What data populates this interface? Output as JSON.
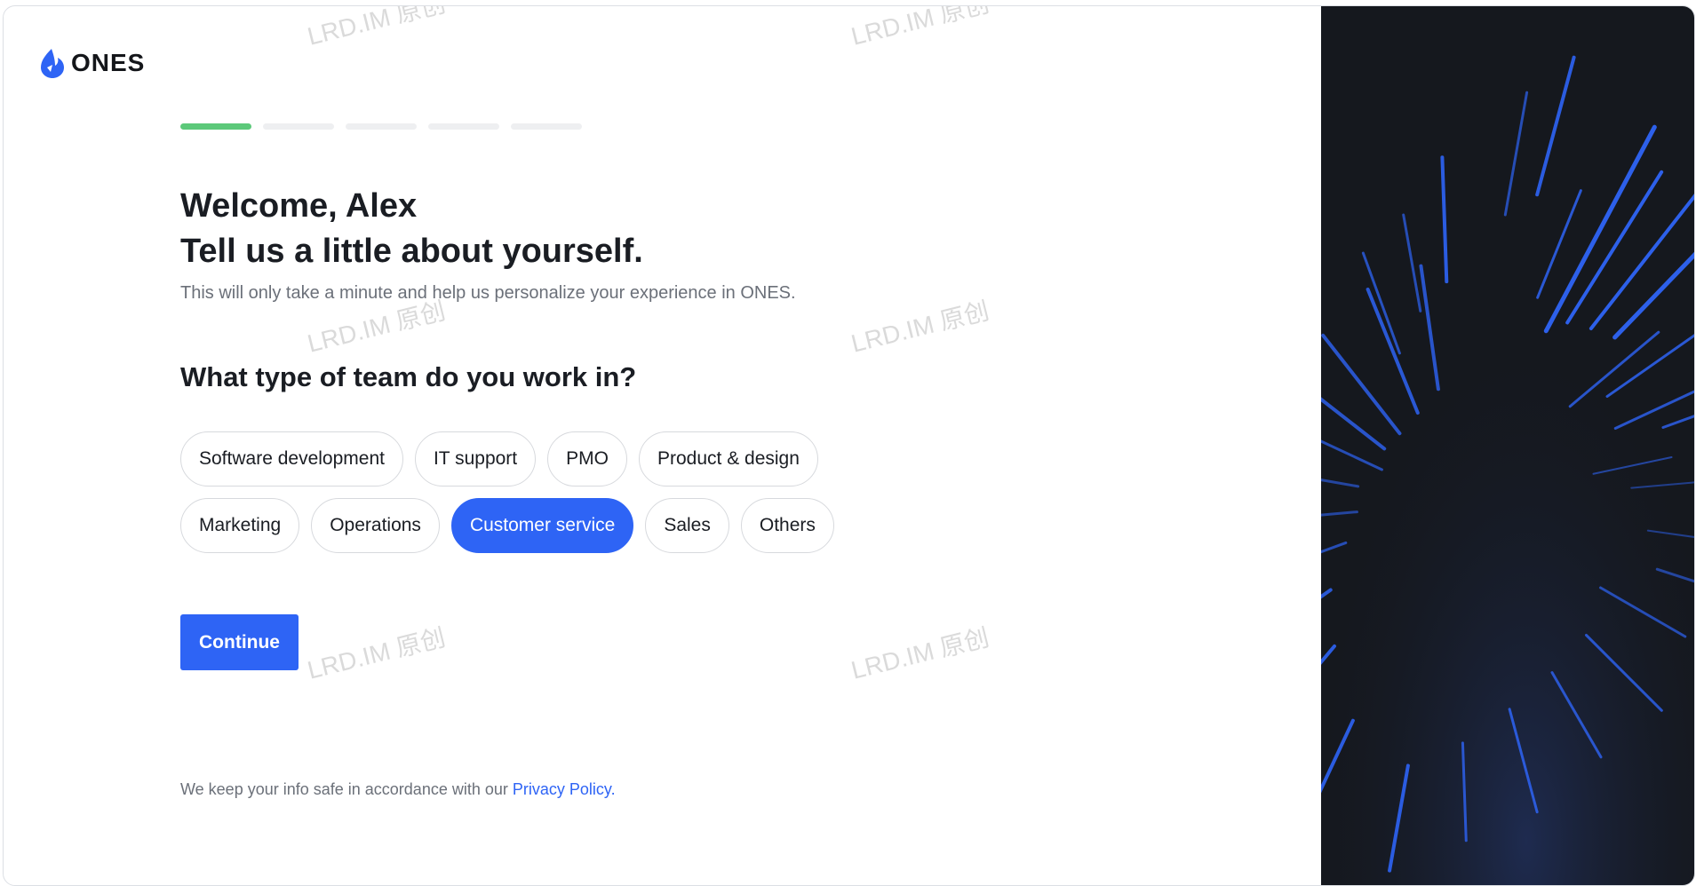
{
  "brand": {
    "name": "ONES",
    "accent": "#2e64f5"
  },
  "progress": {
    "steps": 5,
    "current": 1
  },
  "header": {
    "title_line1": "Welcome, Alex",
    "title_line2": "Tell us a little about yourself.",
    "subtitle": "This will only take a minute and help us personalize your experience in ONES."
  },
  "question": "What type of team do you work in?",
  "options_row1": [
    "Software development",
    "IT support",
    "PMO",
    "Product & design"
  ],
  "options_row2": [
    "Marketing",
    "Operations",
    "Customer service",
    "Sales",
    "Others"
  ],
  "selected": "Customer service",
  "continue_label": "Continue",
  "footer": {
    "text": "We keep your info safe in accordance with our ",
    "link": "Privacy Policy",
    "suffix": "."
  },
  "watermark": "LRD.IM 原创",
  "colors": {
    "progress_active": "#5cc97a",
    "panel_bg": "#15181e",
    "streak": "#2e64f5"
  }
}
